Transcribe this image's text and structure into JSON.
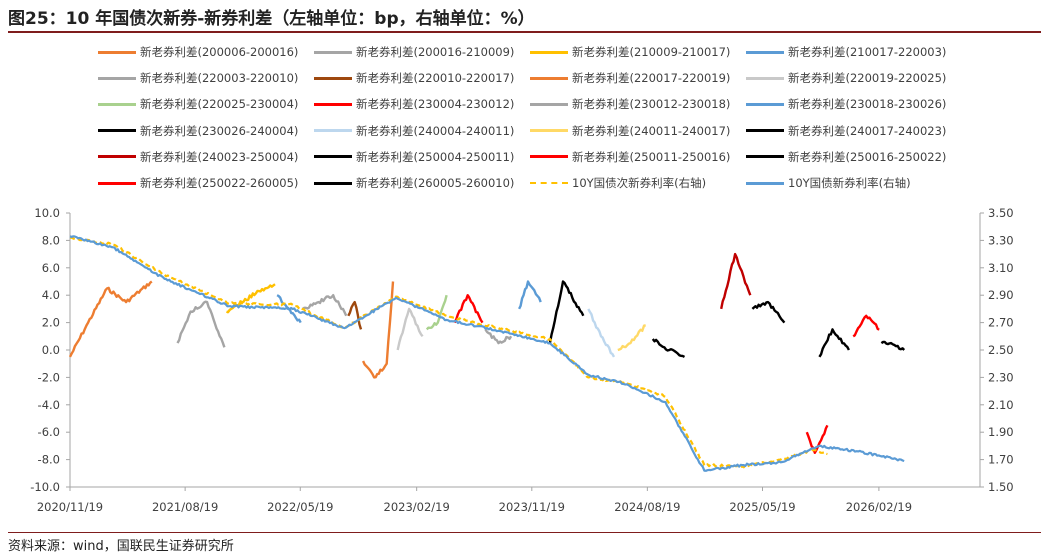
{
  "figure": {
    "title": "图25：10 年国债次新券-新券利差（左轴单位：bp，右轴单位：%）",
    "source": "资料来源：wind，国联民生证券研究所"
  },
  "chart_data": {
    "type": "line",
    "title": "图25：10 年国债次新券-新券利差（左轴单位：bp，右轴单位：%）",
    "xlabel": "",
    "ylabel": "",
    "ylim": [
      -10,
      10
    ],
    "y2lim": [
      1.5,
      3.5
    ],
    "x_ticks": [
      "2020/11/19",
      "2021/08/19",
      "2022/05/19",
      "2023/02/19",
      "2023/11/19",
      "2024/08/19",
      "2025/05/19",
      "2026/02/19"
    ],
    "y_ticks": [
      "10.0",
      "8.0",
      "6.0",
      "4.0",
      "2.0",
      "0.0",
      "-2.0",
      "-4.0",
      "-6.0",
      "-8.0",
      "-10.0"
    ],
    "y2_ticks": [
      "3.50",
      "3.30",
      "3.10",
      "2.90",
      "2.70",
      "2.50",
      "2.30",
      "2.10",
      "1.90",
      "1.70",
      "1.50"
    ],
    "grid": false,
    "legend_position": "top",
    "series": [
      {
        "name": "新老券利差(200006-200016)",
        "color": "#ED7D31",
        "style": "solid",
        "axis": "left",
        "x": [
          "2020/11/19",
          "2021/01/01",
          "2021/02/15",
          "2021/04/01",
          "2021/06/01"
        ],
        "values": [
          -0.5,
          2.0,
          4.5,
          3.5,
          5.0
        ]
      },
      {
        "name": "新老券利差(200016-210009)",
        "color": "#A5A5A5",
        "style": "solid",
        "axis": "left",
        "x": [
          "2021/08/01",
          "2021/09/01",
          "2021/10/10",
          "2021/11/20"
        ],
        "values": [
          0.5,
          2.8,
          3.5,
          0.2
        ]
      },
      {
        "name": "新老券利差(210009-210017)",
        "color": "#FFC000",
        "style": "solid",
        "axis": "left",
        "x": [
          "2021/11/25",
          "2022/01/01",
          "2022/02/10",
          "2022/03/20"
        ],
        "values": [
          2.8,
          3.5,
          4.3,
          4.8
        ]
      },
      {
        "name": "新老券利差(210017-220003)",
        "color": "#5B9BD5",
        "style": "solid",
        "axis": "left",
        "x": [
          "2022/03/25",
          "2022/04/20",
          "2022/05/20"
        ],
        "values": [
          4.0,
          3.0,
          2.0
        ]
      },
      {
        "name": "新老券利差(220003-220010)",
        "color": "#A5A5A5",
        "style": "solid",
        "axis": "left",
        "x": [
          "2022/05/25",
          "2022/07/01",
          "2022/08/05",
          "2022/09/05"
        ],
        "values": [
          3.0,
          3.5,
          4.0,
          2.5
        ]
      },
      {
        "name": "新老券利差(220010-220017)",
        "color": "#9E480E",
        "style": "solid",
        "axis": "left",
        "x": [
          "2022/09/10",
          "2022/09/25",
          "2022/10/10"
        ],
        "values": [
          2.5,
          3.5,
          1.5
        ]
      },
      {
        "name": "新老券利差(220017-220019)",
        "color": "#ED7D31",
        "style": "solid",
        "axis": "left",
        "x": [
          "2022/10/15",
          "2022/11/10",
          "2022/12/10",
          "2022/12/25"
        ],
        "values": [
          -0.8,
          -2.0,
          -1.0,
          5.0
        ]
      },
      {
        "name": "新老券利差(220019-220025)",
        "color": "#C9C9C9",
        "style": "solid",
        "axis": "left",
        "x": [
          "2023/01/05",
          "2023/02/01",
          "2023/03/05"
        ],
        "values": [
          0.0,
          3.0,
          1.0
        ]
      },
      {
        "name": "新老券利差(220025-230004)",
        "color": "#A9D18E",
        "style": "solid",
        "axis": "left",
        "x": [
          "2023/03/15",
          "2023/04/10",
          "2023/05/01"
        ],
        "values": [
          1.5,
          2.0,
          4.0
        ]
      },
      {
        "name": "新老券利差(230004-230012)",
        "color": "#FF0000",
        "style": "solid",
        "axis": "left",
        "x": [
          "2023/05/20",
          "2023/06/20",
          "2023/07/25"
        ],
        "values": [
          2.0,
          4.0,
          2.0
        ]
      },
      {
        "name": "新老券利差(230012-230018)",
        "color": "#A5A5A5",
        "style": "solid",
        "axis": "left",
        "x": [
          "2023/08/01",
          "2023/09/01",
          "2023/10/01"
        ],
        "values": [
          1.5,
          0.5,
          1.0
        ]
      },
      {
        "name": "新老券利差(230018-230026)",
        "color": "#5B9BD5",
        "style": "solid",
        "axis": "left",
        "x": [
          "2023/10/20",
          "2023/11/10",
          "2023/12/10"
        ],
        "values": [
          3.0,
          5.0,
          3.5
        ]
      },
      {
        "name": "新老券利差(230026-240004)",
        "color": "#000000",
        "style": "solid",
        "axis": "left",
        "x": [
          "2024/01/01",
          "2024/02/01",
          "2024/03/20"
        ],
        "values": [
          0.5,
          5.0,
          2.5
        ]
      },
      {
        "name": "新老券利差(240004-240011)",
        "color": "#BDD7EE",
        "style": "solid",
        "axis": "left",
        "x": [
          "2024/04/01",
          "2024/05/01",
          "2024/06/01"
        ],
        "values": [
          3.0,
          1.0,
          -0.5
        ]
      },
      {
        "name": "新老券利差(240011-240017)",
        "color": "#FFD966",
        "style": "solid",
        "axis": "left",
        "x": [
          "2024/06/10",
          "2024/07/10",
          "2024/08/15"
        ],
        "values": [
          0.0,
          0.5,
          1.8
        ]
      },
      {
        "name": "新老券利差(240017-240023)",
        "color": "#000000",
        "style": "solid",
        "axis": "left",
        "x": [
          "2024/09/01",
          "2024/10/10",
          "2024/11/15"
        ],
        "values": [
          0.8,
          0.0,
          -0.5
        ]
      },
      {
        "name": "新老券利差(240023-250004)",
        "color": "#C00000",
        "style": "solid",
        "axis": "left",
        "x": [
          "2025/02/10",
          "2025/03/15",
          "2025/04/20"
        ],
        "values": [
          3.0,
          7.0,
          4.0
        ]
      },
      {
        "name": "新老券利差(250004-250011)",
        "color": "#000000",
        "style": "solid",
        "axis": "left",
        "x": [
          "2025/04/25",
          "2025/06/01",
          "2025/07/10"
        ],
        "values": [
          3.0,
          3.5,
          2.0
        ]
      },
      {
        "name": "新老券利差(250011-250016)",
        "color": "#FF0000",
        "style": "solid",
        "axis": "left",
        "x": [
          "2025/09/01",
          "2025/09/20",
          "2025/10/20"
        ],
        "values": [
          -6.0,
          -7.5,
          -5.5
        ]
      },
      {
        "name": "新老券利差(250016-250022)",
        "color": "#000000",
        "style": "solid",
        "axis": "left",
        "x": [
          "2025/10/01",
          "2025/11/01",
          "2025/12/10"
        ],
        "values": [
          -0.5,
          1.5,
          0.0
        ]
      },
      {
        "name": "新老券利差(250022-260005)",
        "color": "#FF0000",
        "style": "solid",
        "axis": "left",
        "x": [
          "2025/12/20",
          "2026/01/20",
          "2026/02/20"
        ],
        "values": [
          1.0,
          2.5,
          1.5
        ]
      },
      {
        "name": "新老券利差(260005-260010)",
        "color": "#000000",
        "style": "solid",
        "axis": "left",
        "x": [
          "2026/02/25",
          "2026/03/20",
          "2026/04/20"
        ],
        "values": [
          0.5,
          0.5,
          0.0
        ]
      },
      {
        "name": "10Y国债次新券利率(右轴)",
        "color": "#FFC000",
        "style": "dashed",
        "axis": "right",
        "x": [
          "2020/11/19",
          "2021/03/01",
          "2021/07/01",
          "2021/12/01",
          "2022/05/01",
          "2022/09/01",
          "2023/01/01",
          "2023/05/01",
          "2023/09/01",
          "2024/01/01",
          "2024/04/01",
          "2024/07/01",
          "2024/10/01",
          "2025/01/01",
          "2025/04/01",
          "2025/07/01",
          "2025/09/15",
          "2025/10/20"
        ],
        "values": [
          3.32,
          3.27,
          3.05,
          2.84,
          2.83,
          2.66,
          2.89,
          2.75,
          2.66,
          2.58,
          2.3,
          2.26,
          2.16,
          1.66,
          1.65,
          1.7,
          1.77,
          1.74
        ]
      },
      {
        "name": "10Y国债新券利率(右轴)",
        "color": "#5B9BD5",
        "style": "solid",
        "axis": "right",
        "x": [
          "2020/11/19",
          "2021/03/01",
          "2021/07/01",
          "2021/12/01",
          "2022/05/01",
          "2022/09/01",
          "2023/01/01",
          "2023/05/01",
          "2023/09/01",
          "2024/01/01",
          "2024/04/01",
          "2024/07/01",
          "2024/10/01",
          "2025/01/01",
          "2025/04/01",
          "2025/07/01",
          "2025/10/01",
          "2026/01/01",
          "2026/04/20"
        ],
        "values": [
          3.33,
          3.25,
          3.02,
          2.82,
          2.8,
          2.66,
          2.88,
          2.72,
          2.64,
          2.55,
          2.32,
          2.25,
          2.12,
          1.62,
          1.66,
          1.68,
          1.8,
          1.76,
          1.69
        ]
      }
    ]
  }
}
